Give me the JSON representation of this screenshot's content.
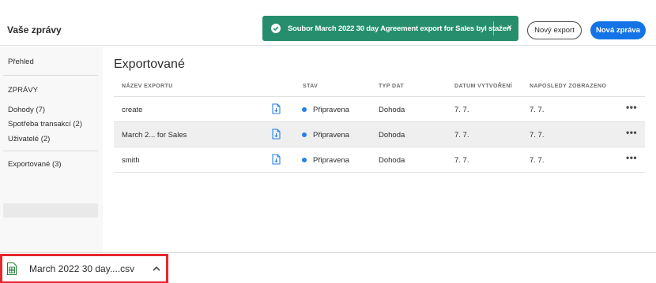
{
  "header": {
    "title": "Vaše zprávy",
    "toast_message": "Soubor March 2022 30 day Agreement export for Sales byl stažen",
    "toast_close": "×",
    "new_export_label": "Nový export",
    "new_report_label": "Nová zpráva"
  },
  "sidebar": {
    "overview": "Přehled",
    "reports_heading": "ZPRÁVY",
    "items": [
      {
        "label": "Dohody (7)"
      },
      {
        "label": "Spotřeba transakcí (2)"
      },
      {
        "label": "Uživatelé (2)"
      }
    ],
    "exported": "Exportované (3)"
  },
  "main": {
    "title": "Exportované",
    "columns": [
      "NÁZEV EXPORTU",
      "STAV",
      "TYP DAT",
      "DATUM VYTVOŘENÍ",
      "NAPOSLEDY ZOBRAZENO"
    ],
    "rows": [
      {
        "name": "create",
        "status": "Připravena",
        "type": "Dohoda",
        "created": "7. 7.",
        "viewed": "7. 7.",
        "more": "•••"
      },
      {
        "name": "March 2... for Sales",
        "status": "Připravena",
        "type": "Dohoda",
        "created": "7. 7.",
        "viewed": "7. 7.",
        "more": "•••"
      },
      {
        "name": "smith",
        "status": "Připravena",
        "type": "Dohoda",
        "created": "7. 7.",
        "viewed": "7. 7.",
        "more": "•••"
      }
    ]
  },
  "download_bar": {
    "file_name": "March 2022 30 day....csv",
    "file_icon": "spreadsheet-file-icon",
    "chevron_icon": "chevron-up-icon"
  },
  "colors": {
    "toast_bg": "#268e6c",
    "primary": "#1473e6",
    "status_ready": "#2680eb",
    "highlight_border": "#e8262d"
  }
}
